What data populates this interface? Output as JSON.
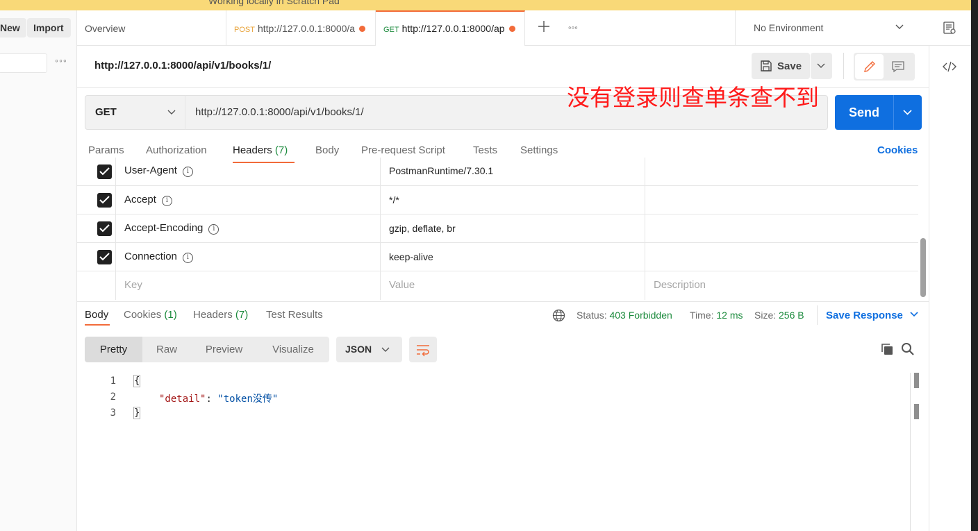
{
  "banner": {
    "text": "Working locally in Scratch Pad"
  },
  "sidebar": {
    "new_label": "New",
    "import_label": "Import"
  },
  "tabs": [
    {
      "label": "Overview"
    },
    {
      "method": "POST",
      "url": "http://127.0.0.1:8000/a"
    },
    {
      "method": "GET",
      "url": "http://127.0.0.1:8000/ap"
    }
  ],
  "environment": {
    "label": "No Environment"
  },
  "request": {
    "title": "http://127.0.0.1:8000/api/v1/books/1/",
    "save_label": "Save",
    "method": "GET",
    "url": "http://127.0.0.1:8000/api/v1/books/1/",
    "send_label": "Send"
  },
  "annotation": "没有登录则查单条查不到",
  "request_tabs": {
    "params": "Params",
    "authorization": "Authorization",
    "headers": "Headers",
    "headers_count": "(7)",
    "body": "Body",
    "prerequest": "Pre-request Script",
    "tests": "Tests",
    "settings": "Settings",
    "cookies": "Cookies"
  },
  "headers_table": {
    "rows": [
      {
        "key": "User-Agent",
        "value": "PostmanRuntime/7.30.1"
      },
      {
        "key": "Accept",
        "value": "*/*"
      },
      {
        "key": "Accept-Encoding",
        "value": "gzip, deflate, br"
      },
      {
        "key": "Connection",
        "value": "keep-alive"
      }
    ],
    "placeholder_key": "Key",
    "placeholder_value": "Value",
    "placeholder_description": "Description"
  },
  "response": {
    "tabs": {
      "body": "Body",
      "cookies": "Cookies",
      "cookies_count": "(1)",
      "headers": "Headers",
      "headers_count": "(7)",
      "tests": "Test Results"
    },
    "status_label": "Status:",
    "status_value": "403 Forbidden",
    "time_label": "Time:",
    "time_value": "12 ms",
    "size_label": "Size:",
    "size_value": "256 B",
    "save_label": "Save Response",
    "modes": [
      "Pretty",
      "Raw",
      "Preview",
      "Visualize"
    ],
    "format": "JSON",
    "lines": [
      "1",
      "2",
      "3"
    ],
    "code": {
      "open": "{",
      "key": "\"detail\"",
      "colon": ": ",
      "value": "\"token没传\"",
      "close": "}"
    }
  },
  "colors": {
    "accent": "#f26b3a",
    "primary": "#0f6fe0",
    "status_ok": "#1b8a3c",
    "annotation": "#ff1a1a",
    "banner": "#f9d978"
  }
}
